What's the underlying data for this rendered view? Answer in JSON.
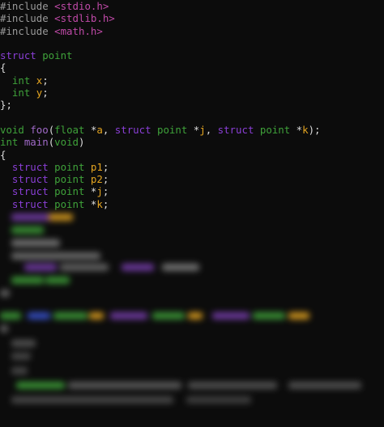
{
  "editor": {
    "lines": [
      [
        {
          "t": "#include ",
          "c": "pp"
        },
        {
          "t": "<stdio.h>",
          "c": "hdr"
        }
      ],
      [
        {
          "t": "#include ",
          "c": "pp"
        },
        {
          "t": "<stdlib.h>",
          "c": "hdr"
        }
      ],
      [
        {
          "t": "#include ",
          "c": "pp"
        },
        {
          "t": "<math.h>",
          "c": "hdr"
        }
      ],
      [],
      [
        {
          "t": "struct ",
          "c": "kw"
        },
        {
          "t": "point",
          "c": "name"
        }
      ],
      [
        {
          "t": "{",
          "c": "punc"
        }
      ],
      [
        {
          "t": "  int ",
          "c": "name"
        },
        {
          "t": "x",
          "c": "var"
        },
        {
          "t": ";",
          "c": "punc"
        }
      ],
      [
        {
          "t": "  int ",
          "c": "name"
        },
        {
          "t": "y",
          "c": "var"
        },
        {
          "t": ";",
          "c": "punc"
        }
      ],
      [
        {
          "t": "};",
          "c": "punc"
        }
      ],
      [],
      [
        {
          "t": "void ",
          "c": "name"
        },
        {
          "t": "foo",
          "c": "fn"
        },
        {
          "t": "(",
          "c": "punc"
        },
        {
          "t": "float ",
          "c": "name"
        },
        {
          "t": "*",
          "c": "punc"
        },
        {
          "t": "a",
          "c": "var"
        },
        {
          "t": ", ",
          "c": "punc"
        },
        {
          "t": "struct ",
          "c": "kw"
        },
        {
          "t": "point ",
          "c": "name"
        },
        {
          "t": "*",
          "c": "punc"
        },
        {
          "t": "j",
          "c": "var"
        },
        {
          "t": ", ",
          "c": "punc"
        },
        {
          "t": "struct ",
          "c": "kw"
        },
        {
          "t": "point ",
          "c": "name"
        },
        {
          "t": "*",
          "c": "punc"
        },
        {
          "t": "k",
          "c": "var"
        },
        {
          "t": ");",
          "c": "punc"
        }
      ],
      [
        {
          "t": "int ",
          "c": "name"
        },
        {
          "t": "main",
          "c": "fn"
        },
        {
          "t": "(",
          "c": "punc"
        },
        {
          "t": "void",
          "c": "name"
        },
        {
          "t": ")",
          "c": "punc"
        }
      ],
      [
        {
          "t": "{",
          "c": "punc"
        }
      ],
      [
        {
          "t": "  struct ",
          "c": "kw"
        },
        {
          "t": "point ",
          "c": "name"
        },
        {
          "t": "p1",
          "c": "var"
        },
        {
          "t": ";",
          "c": "punc"
        }
      ],
      [
        {
          "t": "  struct ",
          "c": "kw"
        },
        {
          "t": "point ",
          "c": "name"
        },
        {
          "t": "p2",
          "c": "var"
        },
        {
          "t": ";",
          "c": "punc"
        }
      ],
      [
        {
          "t": "  struct ",
          "c": "kw"
        },
        {
          "t": "point ",
          "c": "name"
        },
        {
          "t": "*",
          "c": "punc"
        },
        {
          "t": "j",
          "c": "var"
        },
        {
          "t": ";",
          "c": "punc"
        }
      ],
      [
        {
          "t": "  struct ",
          "c": "kw"
        },
        {
          "t": "point ",
          "c": "name"
        },
        {
          "t": "*",
          "c": "punc"
        },
        {
          "t": "k",
          "c": "var"
        },
        {
          "t": ";",
          "c": "punc"
        }
      ]
    ]
  },
  "colors": {
    "background": "#0c0c0c",
    "preprocessor": "#9a9a9a",
    "header": "#c04aa8",
    "keyword": "#8a3fd6",
    "type_name": "#3fa23a",
    "function": "#a06ac8",
    "variable": "#e5a521",
    "punctuation": "#dcdcdc"
  }
}
